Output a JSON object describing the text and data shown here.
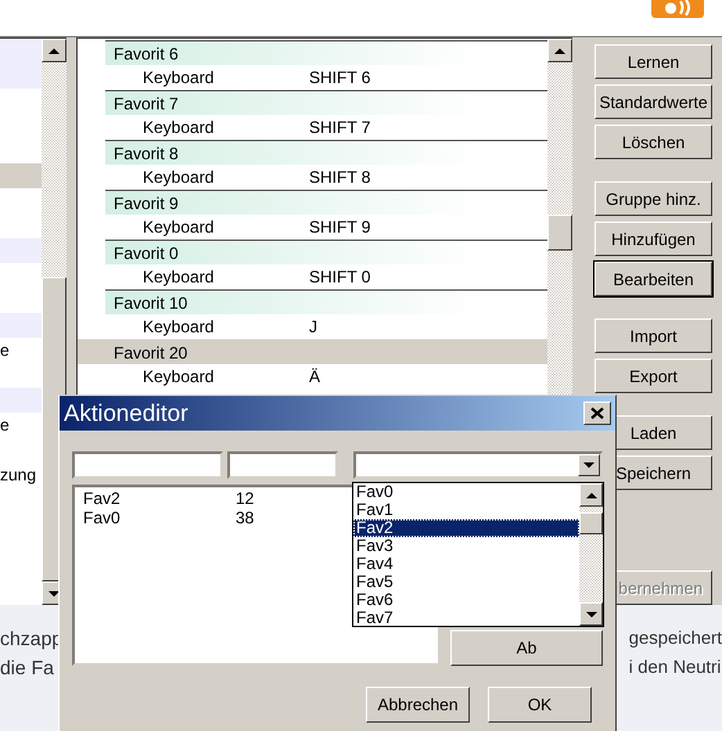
{
  "left_list": {
    "rows": [
      {
        "kind": "stripe"
      },
      {
        "kind": "stripe"
      },
      {
        "kind": "plain"
      },
      {
        "kind": "plain"
      },
      {
        "kind": "plain"
      },
      {
        "kind": "selected"
      },
      {
        "kind": "plain"
      },
      {
        "kind": "plain"
      },
      {
        "kind": "stripe"
      },
      {
        "kind": "plain"
      },
      {
        "kind": "plain"
      },
      {
        "kind": "stripe"
      },
      {
        "kind": "plain",
        "text": "e"
      },
      {
        "kind": "plain"
      },
      {
        "kind": "stripe"
      },
      {
        "kind": "plain",
        "text": "e"
      },
      {
        "kind": "plain"
      },
      {
        "kind": "plain",
        "text": "zung"
      },
      {
        "kind": "plain"
      },
      {
        "kind": "plain"
      },
      {
        "kind": "plain"
      },
      {
        "kind": "plain"
      }
    ]
  },
  "tree": {
    "groups": [
      {
        "name": "Favorit 6",
        "selected": false,
        "actions": [
          {
            "device": "Keyboard",
            "key": "SHIFT 6"
          }
        ]
      },
      {
        "name": "Favorit 7",
        "selected": false,
        "actions": [
          {
            "device": "Keyboard",
            "key": "SHIFT 7"
          }
        ]
      },
      {
        "name": "Favorit 8",
        "selected": false,
        "actions": [
          {
            "device": "Keyboard",
            "key": "SHIFT 8"
          }
        ]
      },
      {
        "name": "Favorit 9",
        "selected": false,
        "actions": [
          {
            "device": "Keyboard",
            "key": "SHIFT 9"
          }
        ]
      },
      {
        "name": "Favorit 0",
        "selected": false,
        "actions": [
          {
            "device": "Keyboard",
            "key": "SHIFT 0"
          }
        ]
      },
      {
        "name": "Favorit 10",
        "selected": false,
        "actions": [
          {
            "device": "Keyboard",
            "key": "J"
          }
        ]
      },
      {
        "name": "Favorit 20",
        "selected": true,
        "actions": [
          {
            "device": "Keyboard",
            "key": "Ä"
          }
        ]
      }
    ]
  },
  "button_groups": [
    [
      {
        "label": "Lernen",
        "default": false,
        "disabled": false
      },
      {
        "label": "Standardwerte",
        "default": false,
        "disabled": false
      },
      {
        "label": "Löschen",
        "default": false,
        "disabled": false
      }
    ],
    [
      {
        "label": "Gruppe hinz.",
        "default": false,
        "disabled": false
      },
      {
        "label": "Hinzufügen",
        "default": false,
        "disabled": false
      },
      {
        "label": "Bearbeiten",
        "default": true,
        "disabled": false
      }
    ],
    [
      {
        "label": "Import",
        "default": false,
        "disabled": false
      },
      {
        "label": "Export",
        "default": false,
        "disabled": false
      }
    ],
    [
      {
        "label": "Laden",
        "default": false,
        "disabled": false
      },
      {
        "label": "Speichern",
        "default": false,
        "disabled": false
      }
    ],
    [
      {
        "label": "bernehmen",
        "default": false,
        "disabled": true
      }
    ]
  ],
  "bottom_text": {
    "left": [
      "chzapp",
      "die Fa"
    ],
    "right": [
      "gespeichert",
      "i den Neutri"
    ]
  },
  "dialog": {
    "title": "Aktioneditor",
    "list_rows": [
      {
        "name": "Fav2",
        "value": "12"
      },
      {
        "name": "Fav0",
        "value": "38"
      }
    ],
    "dropdown_options": [
      {
        "label": "Fav0",
        "selected": false
      },
      {
        "label": "Fav1",
        "selected": false
      },
      {
        "label": "Fav2",
        "selected": true
      },
      {
        "label": "Fav3",
        "selected": false
      },
      {
        "label": "Fav4",
        "selected": false
      },
      {
        "label": "Fav5",
        "selected": false
      },
      {
        "label": "Fav6",
        "selected": false
      },
      {
        "label": "Fav7",
        "selected": false
      }
    ],
    "side_button": "Ab",
    "buttons": [
      "Abbrechen",
      "OK"
    ]
  }
}
